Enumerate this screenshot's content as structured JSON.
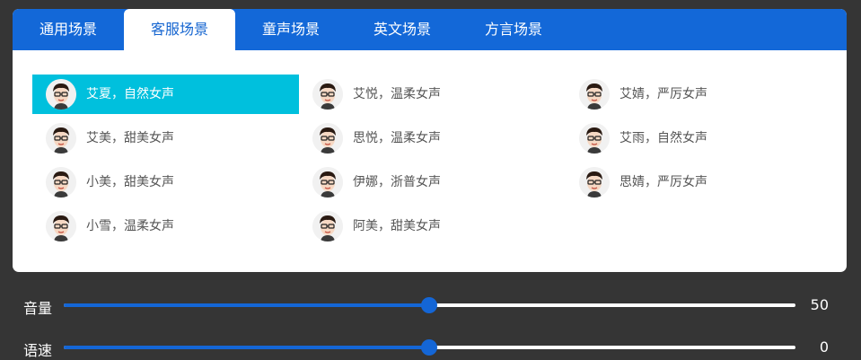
{
  "tabs": [
    {
      "label": "通用场景",
      "active": false
    },
    {
      "label": "客服场景",
      "active": true
    },
    {
      "label": "童声场景",
      "active": false
    },
    {
      "label": "英文场景",
      "active": false
    },
    {
      "label": "方言场景",
      "active": false
    }
  ],
  "voices": [
    {
      "label": "艾夏，自然女声",
      "selected": true
    },
    {
      "label": "艾悦，温柔女声",
      "selected": false
    },
    {
      "label": "艾婧，严厉女声",
      "selected": false
    },
    {
      "label": "艾美，甜美女声",
      "selected": false
    },
    {
      "label": "思悦，温柔女声",
      "selected": false
    },
    {
      "label": "艾雨，自然女声",
      "selected": false
    },
    {
      "label": "小美，甜美女声",
      "selected": false
    },
    {
      "label": "伊娜，浙普女声",
      "selected": false
    },
    {
      "label": "思婧，严厉女声",
      "selected": false
    },
    {
      "label": "小雪，温柔女声",
      "selected": false
    },
    {
      "label": "阿美，甜美女声",
      "selected": false
    }
  ],
  "sliders": {
    "volume": {
      "label": "音量",
      "value": "50",
      "fraction": 0.5
    },
    "speed": {
      "label": "语速",
      "value": "0",
      "fraction": 0.5
    }
  },
  "colors": {
    "tab_bar": "#1368d8",
    "selected_voice": "#00c0dd",
    "slider_accent": "#1466d6",
    "background": "#353535"
  },
  "icons": {
    "avatar": "cartoon-face-avatar-icon"
  }
}
